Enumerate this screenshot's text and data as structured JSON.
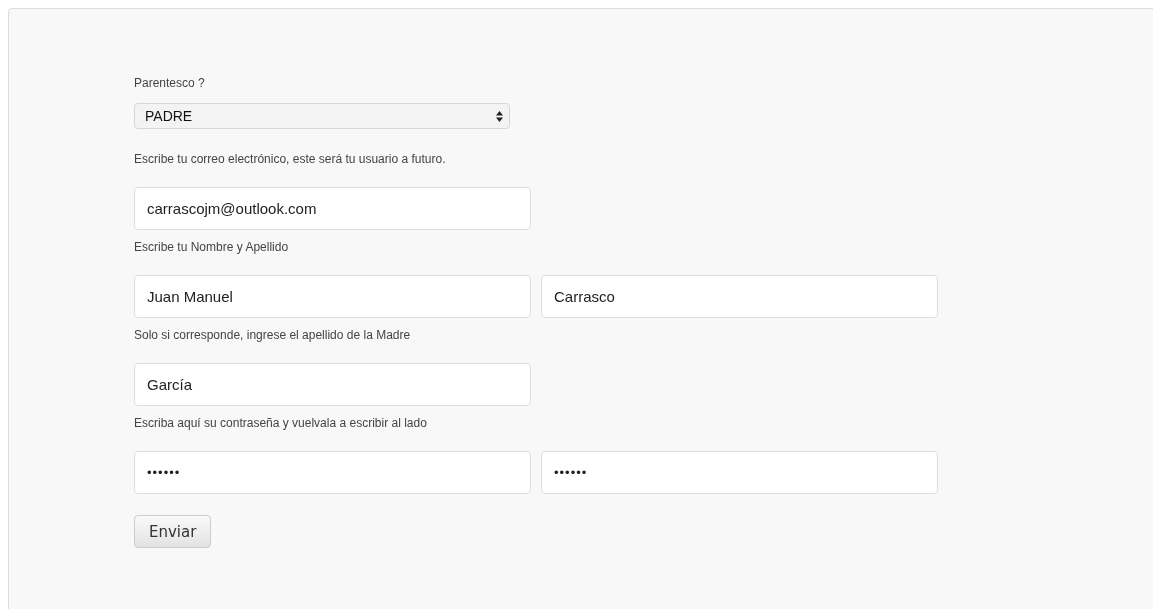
{
  "form": [
    {
      "kind": "select",
      "label": "Parentesco ?",
      "fields": [
        {
          "value": "PADRE"
        }
      ]
    },
    {
      "kind": "text",
      "label": "Escribe tu correo electrónico, este será tu usuario a futuro.",
      "fields": [
        {
          "value": "carrascojm@outlook.com"
        }
      ]
    },
    {
      "kind": "text",
      "label": "Escribe tu Nombre y Apellido",
      "fields": [
        {
          "value": "Juan Manuel"
        },
        {
          "value": "Carrasco"
        }
      ]
    },
    {
      "kind": "text",
      "label": "Solo si corresponde, ingrese el apellido de la Madre",
      "fields": [
        {
          "value": "García"
        }
      ]
    },
    {
      "kind": "password",
      "label": "Escriba aquí su contraseña y vuelvala a escribir al lado",
      "fields": [
        {
          "value": "••••••"
        },
        {
          "value": "••••••"
        }
      ]
    }
  ],
  "submit": "Enviar"
}
